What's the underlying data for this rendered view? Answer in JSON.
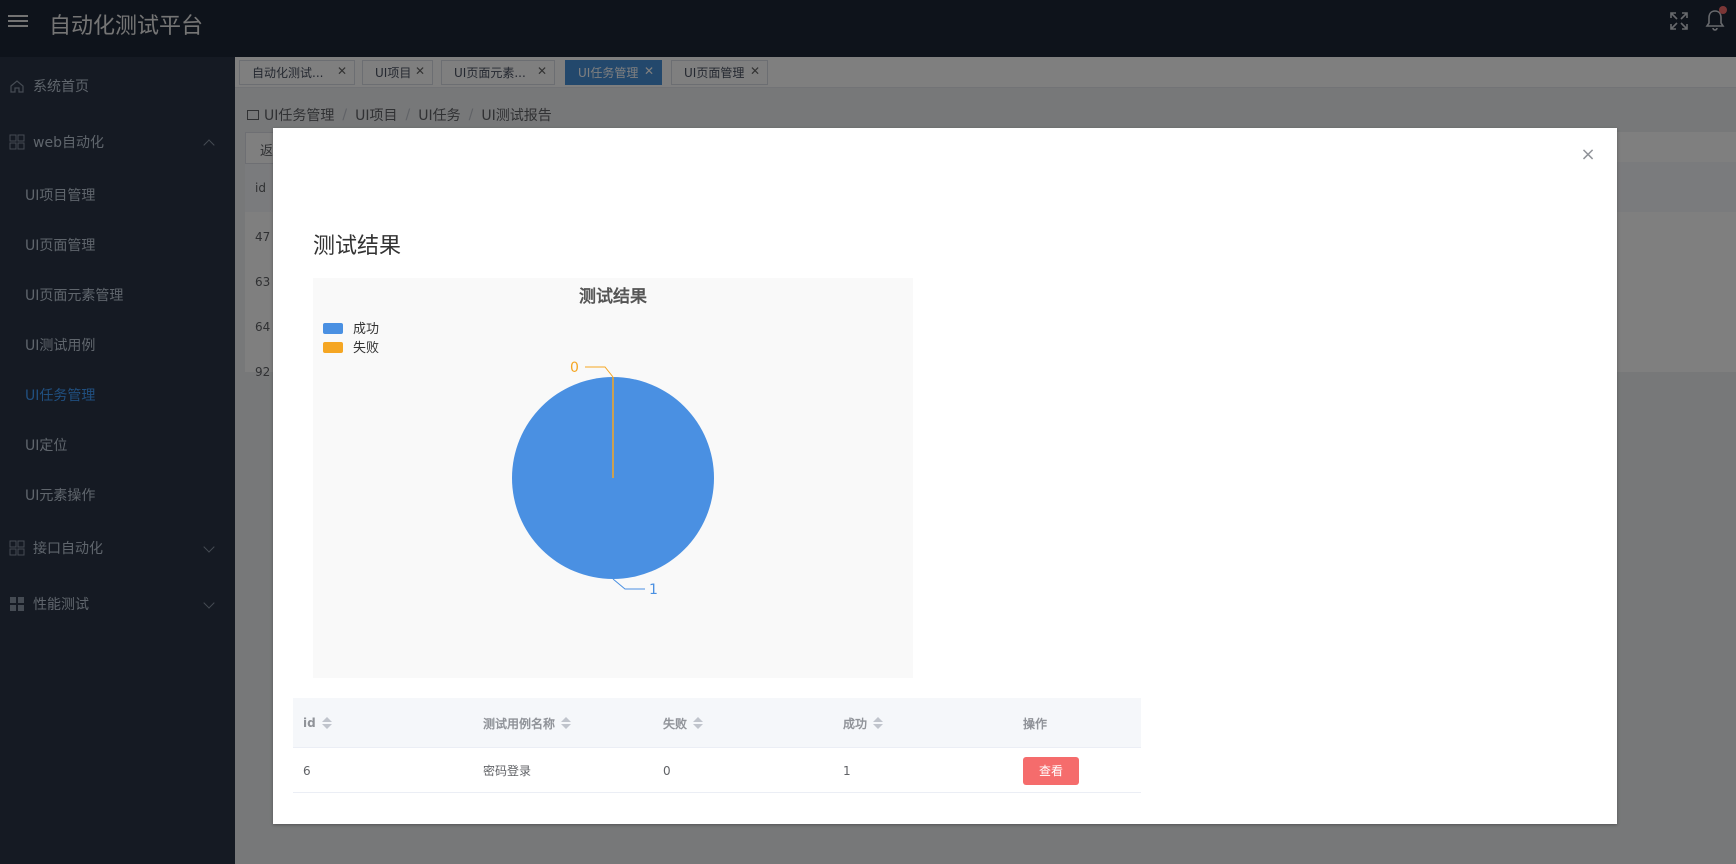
{
  "header": {
    "title": "自动化测试平台"
  },
  "sidebar": {
    "items": [
      {
        "label": "系统首页"
      },
      {
        "label": "web自动化"
      },
      {
        "label": "UI项目管理"
      },
      {
        "label": "UI页面管理"
      },
      {
        "label": "UI页面元素管理"
      },
      {
        "label": "UI测试用例"
      },
      {
        "label": "UI任务管理"
      },
      {
        "label": "UI定位"
      },
      {
        "label": "UI元素操作"
      },
      {
        "label": "接口自动化"
      },
      {
        "label": "性能测试"
      }
    ],
    "active_color": "#409eff"
  },
  "tabs": [
    {
      "label": "自动化测试..."
    },
    {
      "label": "UI项目"
    },
    {
      "label": "UI页面元素..."
    },
    {
      "label": "UI任务管理"
    },
    {
      "label": "UI页面管理"
    }
  ],
  "breadcrumb": [
    "UI任务管理",
    "UI项目",
    "UI任务",
    "UI测试报告"
  ],
  "background_table": {
    "button_label": "返",
    "header_id": "id",
    "ids": [
      "47",
      "63",
      "64",
      "92"
    ]
  },
  "dialog": {
    "heading": "测试结果",
    "close_glyph": "×",
    "table": {
      "headers": [
        "id",
        "测试用例名称",
        "失败",
        "成功",
        "操作"
      ],
      "rows": [
        {
          "id": "6",
          "name": "密码登录",
          "fail": "0",
          "success": "1",
          "action": "查看"
        }
      ]
    }
  },
  "chart_data": {
    "type": "pie",
    "title": "测试结果",
    "legend_position": "top-left",
    "series": [
      {
        "name": "成功",
        "value": 1,
        "color": "#4a90e2"
      },
      {
        "name": "失败",
        "value": 0,
        "color": "#f5a623"
      }
    ]
  }
}
